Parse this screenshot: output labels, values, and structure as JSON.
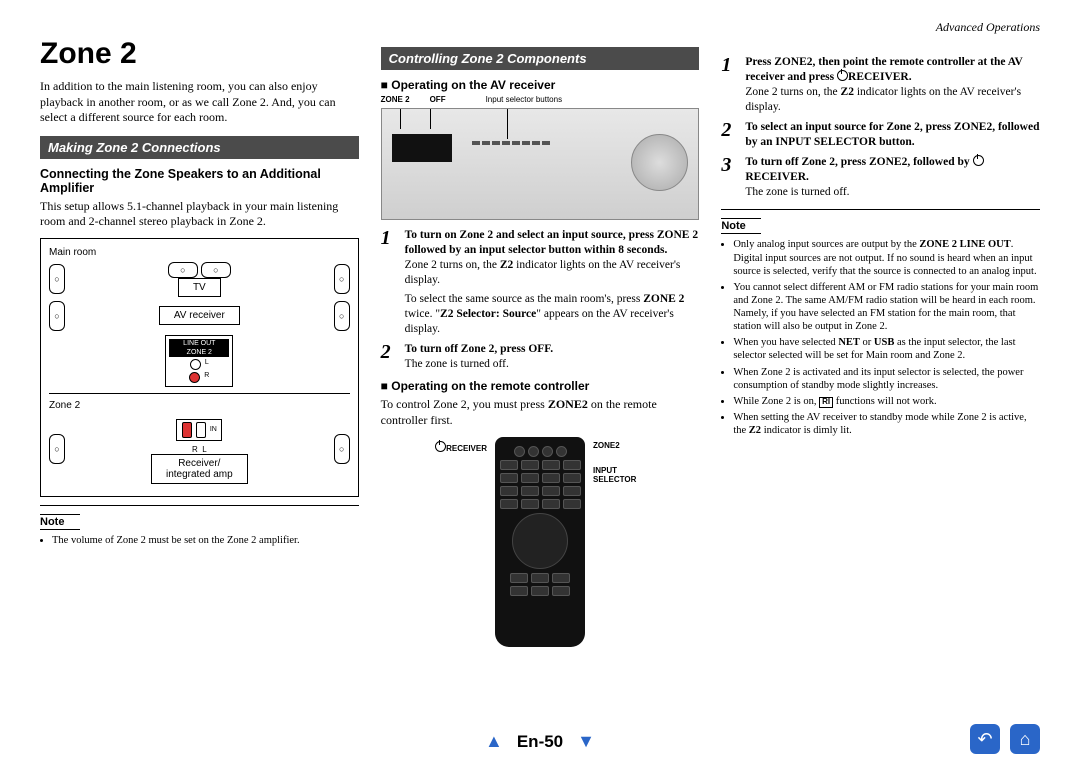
{
  "header": {
    "section": "Advanced Operations"
  },
  "col1": {
    "title": "Zone 2",
    "intro": "In addition to the main listening room, you can also enjoy playback in another room, or as we call Zone 2. And, you can select a different source for each room.",
    "bar1": "Making Zone 2 Connections",
    "sub1": "Connecting the Zone Speakers to an Additional Amplifier",
    "p1": "This setup allows 5.1-channel playback in your main listening room and 2-channel stereo playback in Zone 2.",
    "diag": {
      "main_room": "Main room",
      "tv": "TV",
      "av": "AV receiver",
      "lineout1": "LINE OUT",
      "lineout2": "ZONE 2",
      "l": "L",
      "r": "R",
      "zone2": "Zone 2",
      "in": "IN",
      "amp": "Receiver/\nintegrated amp"
    },
    "note_label": "Note",
    "note1": "The volume of Zone 2 must be set on the Zone 2 amplifier."
  },
  "col2": {
    "bar": "Controlling Zone 2 Components",
    "m1": "Operating on the AV receiver",
    "imglabels": {
      "z2": "ZONE 2",
      "off": "OFF",
      "isb": "Input selector buttons"
    },
    "s1n": "1",
    "s1a": "To turn on Zone 2 and select an input source, press ZONE 2 followed by an input selector button within 8 seconds.",
    "s1b": "Zone 2 turns on, the ",
    "s1b_z2": "Z2",
    "s1b2": " indicator lights on the AV receiver's display.",
    "s1c1": "To select the same source as the main room's, press ",
    "s1c_b": "ZONE 2",
    "s1c2": " twice. \"",
    "s1c_q": "Z2 Selector: Source",
    "s1c3": "\" appears on the AV receiver's display.",
    "s2n": "2",
    "s2a": "To turn off Zone 2, press OFF.",
    "s2b": "The zone is turned off.",
    "m2": "Operating on the remote controller",
    "p_rc1": "To control Zone 2, you must press ",
    "p_rc_b": "ZONE2",
    "p_rc2": " on the remote controller first.",
    "rlabels": {
      "receiver": "RECEIVER",
      "zone2": "ZONE2",
      "input": "INPUT\nSELECTOR"
    }
  },
  "col3": {
    "s1n": "1",
    "s1a": "Press ZONE2, then point the remote controller at the AV receiver and press ",
    "s1a2": "RECEIVER.",
    "s1b": "Zone 2 turns on, the ",
    "s1b_z2": "Z2",
    "s1b2": " indicator lights on the AV receiver's display.",
    "s2n": "2",
    "s2": "To select an input source for Zone 2, press ZONE2, followed by an INPUT SELECTOR button.",
    "s3n": "3",
    "s3a": "To turn off Zone 2, press ZONE2, followed by ",
    "s3a2": "RECEIVER.",
    "s3b": "The zone is turned off.",
    "note_label": "Note",
    "n1a": "Only analog input sources are output by the ",
    "n1b": "ZONE 2 LINE OUT",
    "n1c": ". Digital input sources are not output. If no sound is heard when an input source is selected, verify that the source is connected to an analog input.",
    "n2": "You cannot select different AM or FM radio stations for your main room and Zone 2. The same AM/FM radio station will be heard in each room. Namely, if you have selected an FM station for the main room, that station will also be output in Zone 2.",
    "n3a": "When you have selected ",
    "n3b": "NET",
    "n3c": " or ",
    "n3d": "USB",
    "n3e": " as the input selector, the last selector selected will be set for Main room and Zone 2.",
    "n4": "When Zone 2 is activated and its input selector is selected, the power consumption of standby mode slightly increases.",
    "n5a": "While Zone 2 is on, ",
    "n5b": " functions will not work.",
    "n6a": "When setting the AV receiver to standby mode while Zone 2 is active, the ",
    "n6b": "Z2",
    "n6c": " indicator is dimly lit."
  },
  "footer": {
    "page": "En-50"
  }
}
